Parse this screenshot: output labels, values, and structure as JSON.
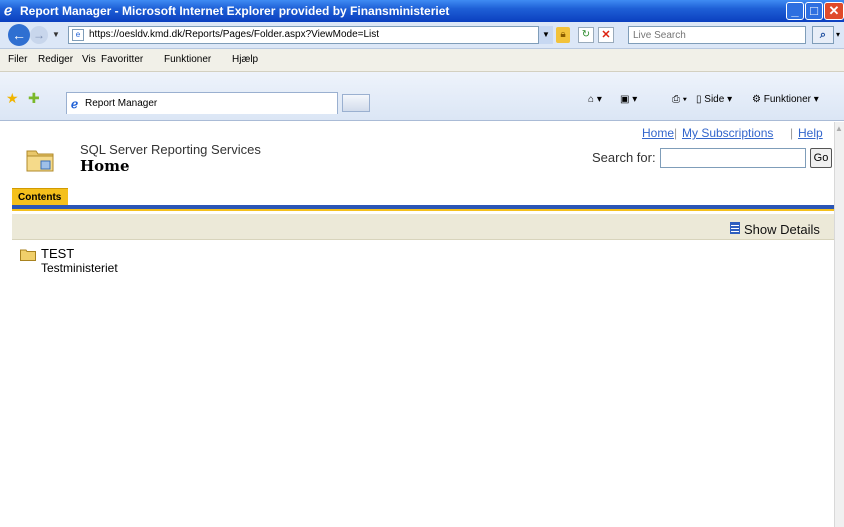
{
  "window": {
    "title": "Report Manager - Microsoft Internet Explorer provided by Finansministeriet",
    "minimize": "_",
    "maximize": "□",
    "close": "✕"
  },
  "address_bar": {
    "url": "https://oesldv.kmd.dk/Reports/Pages/Folder.aspx?ViewMode=List",
    "search_placeholder": "Live Search"
  },
  "menu": {
    "items": [
      "Filer",
      "Rediger",
      "Vis",
      "Favoritter",
      "Funktioner",
      "Hjælp"
    ]
  },
  "tabs": {
    "active_label": "Report Manager"
  },
  "toolbar": {
    "page_label": "Side",
    "tools_label": "Funktioner"
  },
  "report_manager": {
    "links": {
      "home": "Home",
      "subscriptions": "My Subscriptions",
      "help": "Help",
      "separator": "|"
    },
    "product_name": "SQL Server Reporting Services",
    "page_title": "Home",
    "search_label": "Search for:",
    "search_value": "",
    "go_label": "Go",
    "contents_tab": "Contents",
    "show_details": "Show Details",
    "items": [
      {
        "name": "TEST",
        "description": "Testministeriet"
      }
    ]
  },
  "colors": {
    "titlebar": "#1e5fd6",
    "accent_blue": "#2b56b5",
    "accent_yellow": "#f4c01c",
    "link": "#3366cc"
  }
}
